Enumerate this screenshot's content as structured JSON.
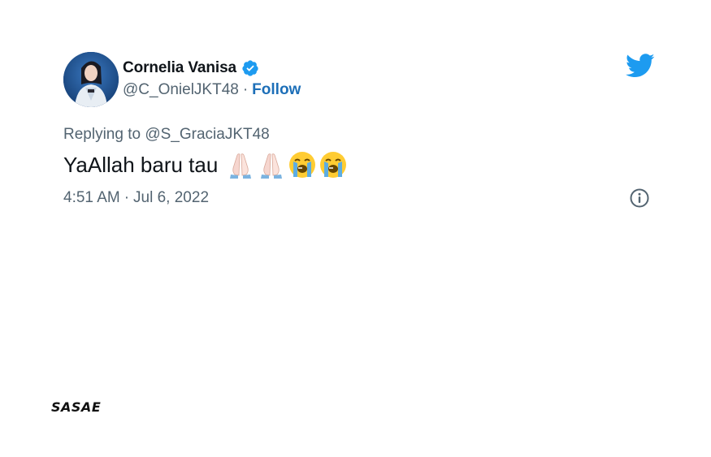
{
  "tweet": {
    "display_name": "Cornelia Vanisa",
    "handle": "@C_OnielJKT48",
    "separator": "·",
    "follow_label": "Follow",
    "reply_prefix": "Replying to",
    "reply_to_handle": "@S_GraciaJKT48",
    "text": "YaAllah baru tau",
    "emojis": [
      "folded-hands",
      "folded-hands",
      "loudly-crying-face",
      "loudly-crying-face"
    ],
    "time": "4:51 AM",
    "date": "Jul 6, 2022"
  },
  "icons": {
    "verified": "verified-badge-icon",
    "brand": "twitter-bird-icon",
    "info": "info-icon"
  },
  "colors": {
    "verified_blue": "#1d9bf0",
    "follow_blue": "#1d6fb8",
    "twitter_blue": "#1d9bf0",
    "secondary_text": "#536471",
    "primary_text": "#0f1419"
  },
  "watermark": {
    "text": "SASAE"
  }
}
